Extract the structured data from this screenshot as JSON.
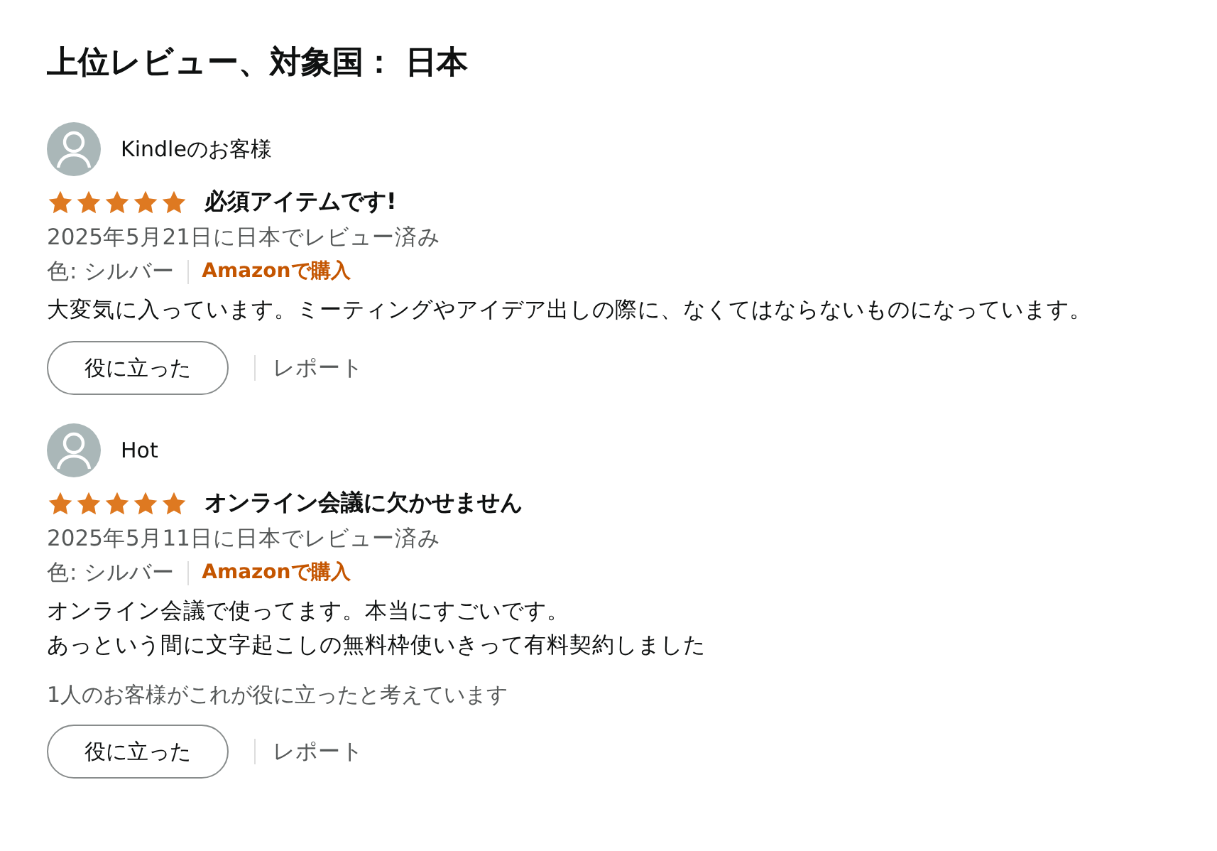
{
  "heading": "上位レビュー、対象国： 日本",
  "reviews": [
    {
      "author": "Kindleのお客様",
      "stars": 5,
      "title": "必須アイテムです!",
      "date": "2025年5月21日に日本でレビュー済み",
      "variant": "色: シルバー",
      "badge": "Amazonで購入",
      "body": [
        "大変気に入っています。ミーティングやアイデア出しの際に、なくてはならないものになっています。"
      ],
      "helpful_button": "役に立った",
      "report": "レポート"
    },
    {
      "author": "Hot",
      "stars": 5,
      "title": "オンライン会議に欠かせません",
      "date": "2025年5月11日に日本でレビュー済み",
      "variant": "色: シルバー",
      "badge": "Amazonで購入",
      "body": [
        "オンライン会議で使ってます。本当にすごいです。",
        "あっという間に文字起こしの無料枠使いきって有料契約しました"
      ],
      "helpful_count": "1人のお客様がこれが役に立ったと考えています",
      "helpful_button": "役に立った",
      "report": "レポート"
    }
  ]
}
